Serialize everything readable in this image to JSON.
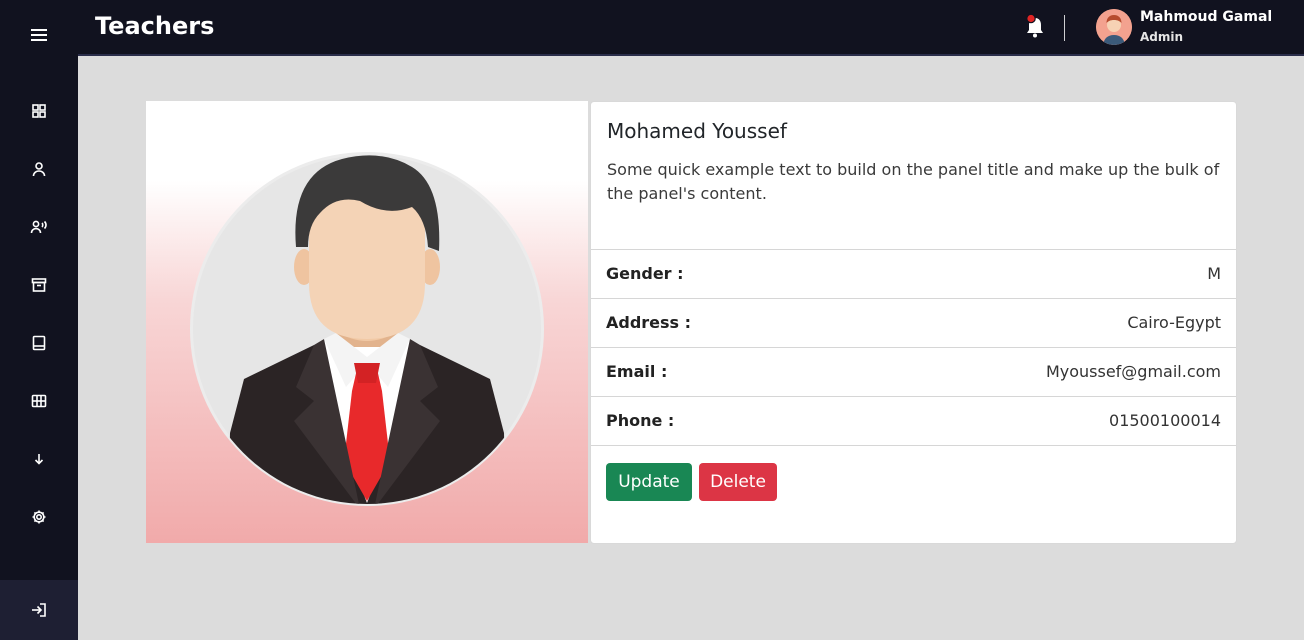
{
  "header": {
    "title": "Teachers",
    "notification_icon": "bell-icon",
    "user": {
      "name": "Mahmoud Gamal",
      "role": "Admin"
    }
  },
  "sidebar": {
    "menu_icon": "hamburger-icon",
    "items": [
      {
        "icon": "dashboard-grid-icon"
      },
      {
        "icon": "user-icon"
      },
      {
        "icon": "users-speaking-icon"
      },
      {
        "icon": "archive-box-icon"
      },
      {
        "icon": "book-icon"
      },
      {
        "icon": "table-icon"
      },
      {
        "icon": "arrow-down-icon"
      },
      {
        "icon": "gear-icon"
      }
    ],
    "logout_icon": "logout-icon"
  },
  "profile": {
    "name": "Mohamed Youssef",
    "description": "Some quick example text to build on the panel title and make up the bulk of the panel's content.",
    "fields": [
      {
        "label": "Gender :",
        "value": "M"
      },
      {
        "label": "Address :",
        "value": "Cairo-Egypt"
      },
      {
        "label": "Email :",
        "value": "Myoussef@gmail.com"
      },
      {
        "label": "Phone :",
        "value": "01500100014"
      }
    ],
    "actions": {
      "update": "Update",
      "delete": "Delete"
    }
  },
  "colors": {
    "sidebar_bg": "#11121f",
    "page_bg": "#dcdcdc",
    "update": "#198754",
    "delete": "#dc3545",
    "notification_dot": "#e02424"
  }
}
